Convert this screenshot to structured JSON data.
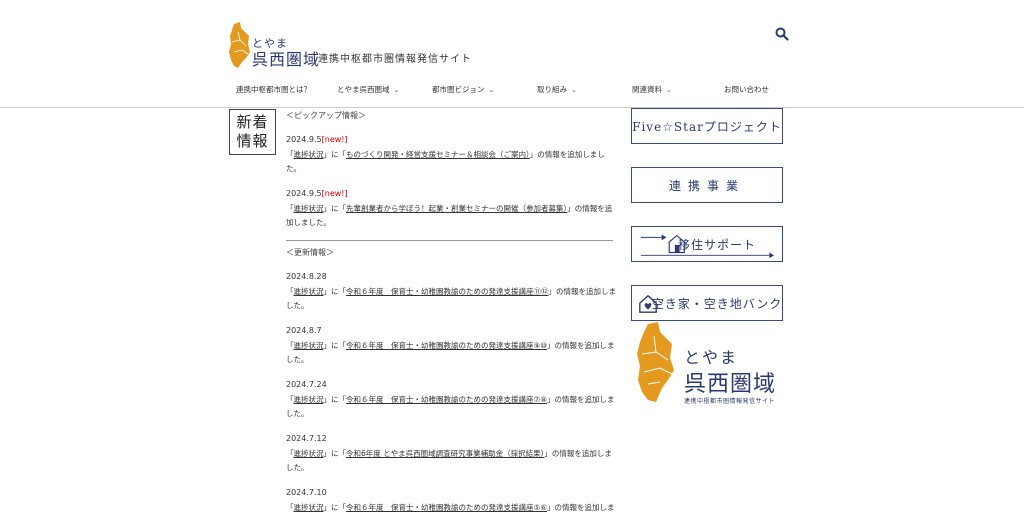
{
  "header": {
    "logo_small": "とやま",
    "logo_big": "呉西圏域",
    "subtitle": "連携中枢都市圏情報発信サイト",
    "search_icon": "search-icon",
    "logo_color": "#e39a1e",
    "brand_color": "#2b3a6e"
  },
  "nav": [
    {
      "label": "連携中枢都市圏とは？",
      "caret": ""
    },
    {
      "label": "とやま呉西圏域",
      "caret": "⌄"
    },
    {
      "label": "都市圏ビジョン",
      "caret": "⌄"
    },
    {
      "label": "取り組み",
      "caret": "⌄"
    },
    {
      "label": "関連資料",
      "caret": "⌄"
    },
    {
      "label": "お問い合わせ",
      "caret": ""
    }
  ],
  "news_label": {
    "line1": "新着",
    "line2": "情報"
  },
  "pickup": {
    "heading": "＜ピックアップ情報＞",
    "entries": [
      {
        "date": "2024.9.5",
        "new_badge": "[new!]",
        "pre": "「",
        "link1": "進捗状況",
        "mid": "」に「",
        "link2": "ものづくり開発・経営支援セミナー＆相談会（ご案内）",
        "post": "」の情報を追加しました。"
      },
      {
        "date": "2024.9.5",
        "new_badge": "[new!]",
        "pre": "「",
        "link1": "進捗状況",
        "mid": "」に「",
        "link2": "先輩創業者から学ぼう！起業・創業セミナーの開催（参加者募集）",
        "post": "」の情報を追加しました。"
      }
    ]
  },
  "updates": {
    "heading": "＜更新情報＞",
    "entries": [
      {
        "date": "2024.8.28",
        "pre": "「",
        "link1": "進捗状況",
        "mid": "」に「",
        "link2": "令和６年度　保育士・幼稚園教諭のための発達支援講座⑪⑫",
        "post": "」の情報を追加しました。"
      },
      {
        "date": "2024.8.7",
        "pre": "「",
        "link1": "進捗状況",
        "mid": "」に「",
        "link2": "令和６年度　保育士・幼稚園教諭のための発達支援講座⑨⑩",
        "post": "」の情報を追加しました。"
      },
      {
        "date": "2024.7.24",
        "pre": "「",
        "link1": "進捗状況",
        "mid": "」に「",
        "link2": "令和６年度　保育士・幼稚園教諭のための発達支援講座⑦⑧",
        "post": "」の情報を追加しました。"
      },
      {
        "date": "2024.7.12",
        "pre": "「",
        "link1": "進捗状況",
        "mid": "」に「",
        "link2": "令和6年度 とやま呉西圏域調査研究事業補助金（採択結果）",
        "post": "」の情報を追加しました。"
      },
      {
        "date": "2024.7.10",
        "pre": "「",
        "link1": "進捗状況",
        "mid": "」に「",
        "link2": "令和６年度　保育士・幼稚園教諭のための発達支援講座⑤⑥",
        "post": "」の情報を追加しました。"
      }
    ]
  },
  "side": {
    "btn1": "Five☆Starプロジェクト",
    "btn2": "連携事業",
    "btn3": "移住サポート",
    "btn4": "空き家・空き地バンク",
    "btn3_icon": "house-arrow-icon",
    "btn4_icon": "house-heart-icon"
  },
  "big_logo": {
    "small": "とやま",
    "big": "呉西圏域",
    "sub": "連携中枢都市圏情報発信サイト"
  }
}
